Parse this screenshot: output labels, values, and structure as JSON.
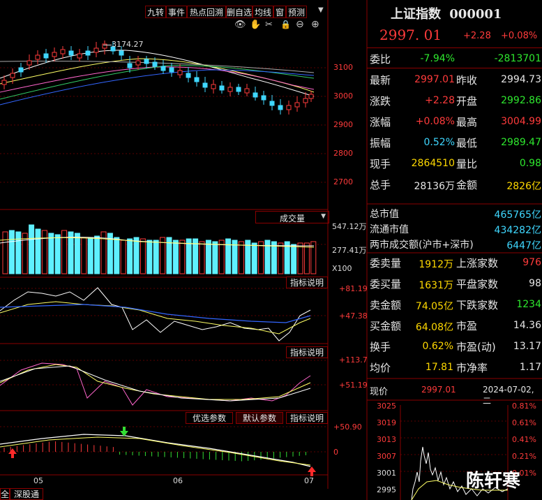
{
  "toolbar": {
    "buttons": [
      "九转",
      "事件",
      "热点回溯",
      "删自选",
      "均线",
      "窗",
      "预测"
    ]
  },
  "chart_tools": [
    "eye-icon",
    "hand-icon",
    "scissors-icon",
    "lock-icon",
    "zoom-out-icon",
    "zoom-in-icon"
  ],
  "main_chart": {
    "high_label": "3174.27",
    "y_ticks": [
      "3100",
      "3000",
      "2900",
      "2800",
      "2700"
    ]
  },
  "volume": {
    "selector": "成交量",
    "ticks": [
      "547.12万",
      "277.41万"
    ],
    "unit": "X100"
  },
  "indicator1": {
    "button": "指标说明",
    "ticks": [
      "+81.19",
      "+47.38"
    ]
  },
  "indicator2": {
    "button": "指标说明",
    "ticks": [
      "+113.7",
      "+51.19"
    ]
  },
  "indicator3": {
    "buttons": [
      "优选参数",
      "默认参数",
      "指标说明"
    ],
    "ticks": [
      "+50.90",
      "0"
    ]
  },
  "x_axis": [
    "05",
    "06",
    "07"
  ],
  "bottom_tabs": [
    "全",
    "深股通"
  ],
  "quote": {
    "name": "上证指数",
    "code": "000001",
    "price": "2997. 01",
    "change": "+2.28",
    "pct": "+0.08%",
    "webi_label": "委比",
    "webi_pct": "-7.94%",
    "webi_diff": "-2813701",
    "rows": [
      {
        "l1": "最新",
        "v1": "2997.01",
        "c1": "red",
        "l2": "昨收",
        "v2": "2994.73",
        "c2": "wht"
      },
      {
        "l1": "涨跌",
        "v1": "+2.28",
        "c1": "red",
        "l2": "开盘",
        "v2": "2992.86",
        "c2": "grn"
      },
      {
        "l1": "涨幅",
        "v1": "+0.08%",
        "c1": "red",
        "l2": "最高",
        "v2": "3004.99",
        "c2": "red"
      },
      {
        "l1": "振幅",
        "v1": "0.52%",
        "c1": "cyan",
        "l2": "最低",
        "v2": "2989.47",
        "c2": "grn"
      },
      {
        "l1": "现手",
        "v1": "2864510",
        "c1": "yel",
        "l2": "量比",
        "v2": "0.98",
        "c2": "grn"
      },
      {
        "l1": "总手",
        "v1": "28136万",
        "c1": "wht",
        "l2": "金额",
        "v2": "2826亿",
        "c2": "yel"
      }
    ],
    "market": [
      {
        "l": "总市值",
        "v": "465765亿"
      },
      {
        "l": "流通市值",
        "v": "434282亿"
      },
      {
        "l": "两市成交额(沪市+深市)",
        "v": "6447亿"
      }
    ],
    "breadth": [
      {
        "l1": "委卖量",
        "v1": "1912万",
        "c1": "yel",
        "l2": "上涨家数",
        "v2": "976",
        "c2": "red"
      },
      {
        "l1": "委买量",
        "v1": "1631万",
        "c1": "yel",
        "l2": "平盘家数",
        "v2": "98",
        "c2": "wht"
      },
      {
        "l1": "卖金额",
        "v1": "74.05亿",
        "c1": "yel",
        "l2": "下跌家数",
        "v2": "1234",
        "c2": "grn"
      },
      {
        "l1": "买金额",
        "v1": "64.08亿",
        "c1": "yel",
        "l2": "市盈",
        "v2": "14.36",
        "c2": "wht"
      },
      {
        "l1": "换手",
        "v1": "0.62%",
        "c1": "yel",
        "l2": "市盈(动)",
        "v2": "13.17",
        "c2": "wht"
      },
      {
        "l1": "均价",
        "v1": "17.81",
        "c1": "yel",
        "l2": "市净率",
        "v2": "1.17",
        "c2": "wht"
      }
    ],
    "now_price_label": "现价",
    "now_price": "2997.01",
    "datetime": "2024-07-02,二"
  },
  "mini_chart": {
    "left_ticks": [
      "3025",
      "3019",
      "3013",
      "3007",
      "3001",
      "2995"
    ],
    "right_ticks": [
      "0.81%",
      "0.61%",
      "0.41%",
      "0.21%",
      "0.01%"
    ]
  },
  "watermark": "陈轩寒",
  "colors": {
    "up": "#ff3b3b",
    "down": "#3fd7ff",
    "frame": "#8a0000",
    "ma_white": "#ffffff",
    "ma_yellow": "#ffff66",
    "ma_pink": "#ff66cc",
    "ma_green": "#33cc66",
    "ma_blue": "#3366ff"
  }
}
